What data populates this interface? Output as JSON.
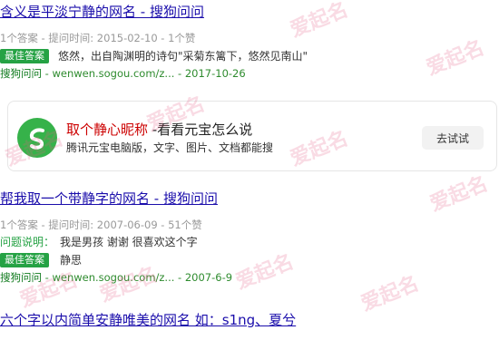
{
  "results": [
    {
      "title": "含义是平淡宁静的网名 - 搜狗问问",
      "meta": "1个答案 - 提问时间: 2015-02-10 - 1个赞",
      "best_label": "最佳答案",
      "best_text": "悠然，出自陶渊明的诗句\"采菊东篱下，悠然见南山\"",
      "source_site": "搜狗问问",
      "source_url": " - wenwen.sogou.com/z... - 2017-10-26"
    },
    {
      "title": "帮我取一个带静字的网名 - 搜狗问问",
      "meta": "1个答案 - 提问时间: 2007-06-09 - 51个赞",
      "question_label": "问题说明：",
      "question_text": "我是男孩 谢谢 很喜欢这个字",
      "best_label": "最佳答案",
      "best_text": "静思",
      "source_site": "搜狗问问",
      "source_url": " - wenwen.sogou.com/z... - 2007-6-9"
    },
    {
      "title": "六个字以内简单安静唯美的网名 如：s1ng、夏兮"
    }
  ],
  "promo": {
    "title_red": "取个静心昵称",
    "title_rest": " -看看元宝怎么说",
    "subtitle": "腾讯元宝电脑版，文字、图片、文档都能搜",
    "button": "去试试"
  },
  "watermark_text": "爱起名",
  "colors": {
    "link": "#1a0dab",
    "badge_green": "#25a244",
    "promo_red": "#cc0000",
    "watermark": "#e25a82"
  }
}
